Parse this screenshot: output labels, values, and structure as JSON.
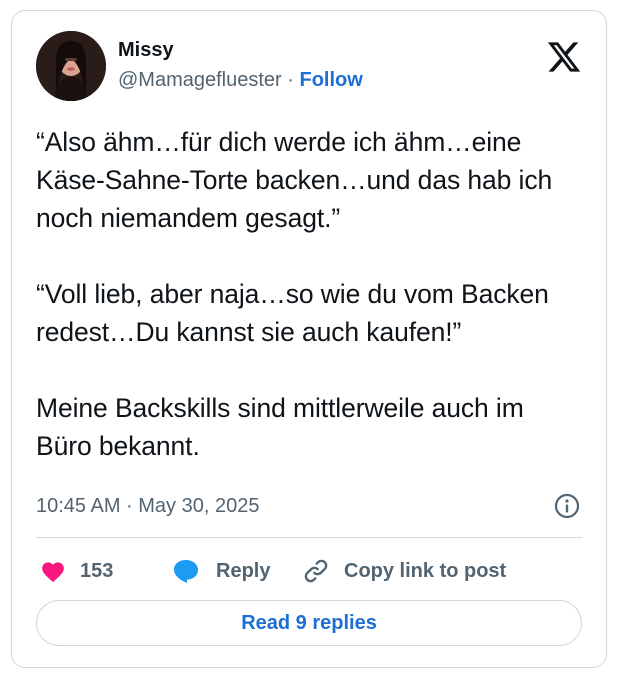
{
  "author": {
    "name": "Missy",
    "handle": "@Mamagefluester",
    "separator": "·",
    "follow_label": "Follow"
  },
  "tweet": {
    "text": "“Also ähm…für dich werde ich ähm…eine Käse-Sahne-Torte backen…und das hab ich noch niemandem gesagt.”\n\n“Voll lieb, aber naja…so wie du vom Backen redest…Du kannst sie auch kaufen!”\n\nMeine Backskills sind mittlerweile auch im Büro bekannt.",
    "timestamp": "10:45 AM · May 30, 2025"
  },
  "actions": {
    "like_count": "153",
    "reply_label": "Reply",
    "copy_label": "Copy link to post"
  },
  "read_replies_label": "Read 9 replies",
  "icons": {
    "brand": "x-logo-icon",
    "like": "heart-icon",
    "reply": "speech-bubble-icon",
    "copy": "link-icon",
    "info": "info-icon"
  },
  "colors": {
    "like": "#f91880",
    "reply": "#1d9bf0",
    "follow": "#1d6fd6",
    "secondary_text": "#536471",
    "border": "#cfd9de"
  }
}
